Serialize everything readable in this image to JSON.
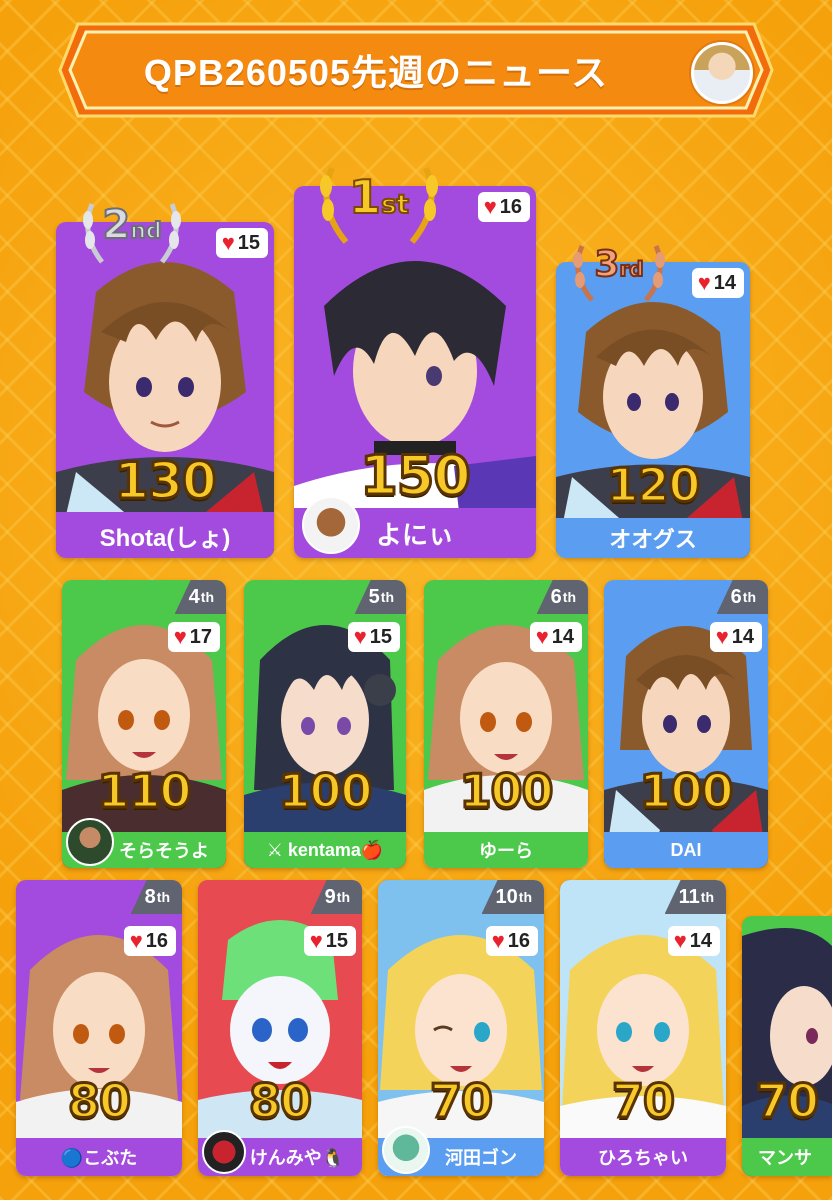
{
  "header": {
    "title": "QPB260505先週のニュース",
    "avatar_icon": "profile-avatar"
  },
  "colors": {
    "purple": "#a44bdf",
    "blue": "#5b9df0",
    "green": "#4cc84a",
    "red": "#e8222e",
    "orange": "#f28a12"
  },
  "podium": [
    {
      "rank": "2",
      "rank_suffix": "nd",
      "likes": "15",
      "score": "130",
      "name": "Shota(しょ)",
      "color": "purple"
    },
    {
      "rank": "1",
      "rank_suffix": "st",
      "likes": "16",
      "score": "150",
      "name": "よにぃ",
      "color": "purple"
    },
    {
      "rank": "3",
      "rank_suffix": "rd",
      "likes": "14",
      "score": "120",
      "name": "オオグス",
      "color": "blue"
    }
  ],
  "row2": [
    {
      "rank": "4",
      "rank_suffix": "th",
      "likes": "17",
      "score": "110",
      "name": "そらそうよ",
      "color": "green"
    },
    {
      "rank": "5",
      "rank_suffix": "th",
      "likes": "15",
      "score": "100",
      "name": "⚔ kentama🍎",
      "color": "green"
    },
    {
      "rank": "6",
      "rank_suffix": "th",
      "likes": "14",
      "score": "100",
      "name": "ゆーら",
      "color": "green"
    },
    {
      "rank": "6",
      "rank_suffix": "th",
      "likes": "14",
      "score": "100",
      "name": "DAI",
      "color": "blue"
    }
  ],
  "row3": [
    {
      "rank": "8",
      "rank_suffix": "th",
      "likes": "16",
      "score": "80",
      "name": "🔵こぶた",
      "color": "purple"
    },
    {
      "rank": "9",
      "rank_suffix": "th",
      "likes": "15",
      "score": "80",
      "name": "けんみや🐧",
      "color": "purple"
    },
    {
      "rank": "10",
      "rank_suffix": "th",
      "likes": "16",
      "score": "70",
      "name": "河田ゴン",
      "color": "blue"
    },
    {
      "rank": "11",
      "rank_suffix": "th",
      "likes": "14",
      "score": "70",
      "name": "ひろちゃい",
      "color": "purple"
    },
    {
      "rank": "",
      "rank_suffix": "",
      "likes": "",
      "score": "70",
      "name": "マンサ",
      "color": "green"
    }
  ]
}
